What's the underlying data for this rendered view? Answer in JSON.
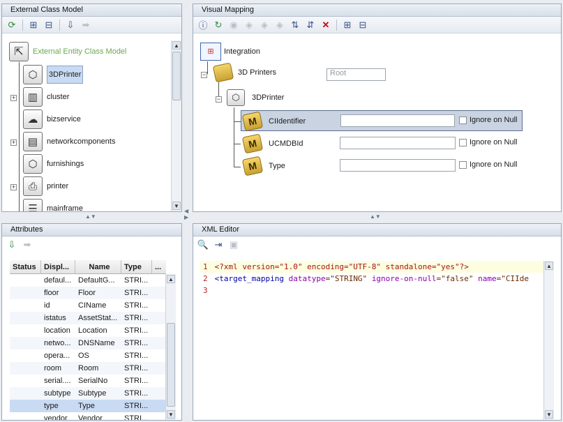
{
  "panels": {
    "external_class_model": {
      "title": "External Class Model",
      "tree": {
        "root_label": "External Entity Class Model",
        "items": [
          {
            "label": "3DPrinter",
            "icon": "cube-icon",
            "selected": true,
            "expandable": false
          },
          {
            "label": "cluster",
            "icon": "cluster-icon",
            "selected": false,
            "expandable": true
          },
          {
            "label": "bizservice",
            "icon": "bizservice-icon",
            "selected": false,
            "expandable": false
          },
          {
            "label": "networkcomponents",
            "icon": "network-icon",
            "selected": false,
            "expandable": true
          },
          {
            "label": "furnishings",
            "icon": "cube-icon",
            "selected": false,
            "expandable": false
          },
          {
            "label": "printer",
            "icon": "printer-icon",
            "selected": false,
            "expandable": true
          },
          {
            "label": "mainframe",
            "icon": "mainframe-icon",
            "selected": false,
            "expandable": false
          }
        ]
      }
    },
    "visual_mapping": {
      "title": "Visual Mapping",
      "root": "Integration",
      "ci_type": "3D Printers",
      "ci_type_placeholder": "Root",
      "entity": "3DPrinter",
      "attributes": [
        {
          "name": "CIIdentifier",
          "value": "",
          "ignore_label": "Ignore on Null",
          "selected": true
        },
        {
          "name": "UCMDBId",
          "value": "",
          "ignore_label": "Ignore on Null",
          "selected": false
        },
        {
          "name": "Type",
          "value": "",
          "ignore_label": "Ignore on Null",
          "selected": false
        }
      ]
    },
    "attributes": {
      "title": "Attributes",
      "columns": [
        "Status",
        "Displ...",
        "Name",
        "Type",
        "..."
      ],
      "rows": [
        {
          "display": "defaul...",
          "name": "DefaultG...",
          "type": "STRI..."
        },
        {
          "display": "floor",
          "name": "Floor",
          "type": "STRI..."
        },
        {
          "display": "id",
          "name": "CIName",
          "type": "STRI..."
        },
        {
          "display": "istatus",
          "name": "AssetStat...",
          "type": "STRI..."
        },
        {
          "display": "location",
          "name": "Location",
          "type": "STRI..."
        },
        {
          "display": "netwo...",
          "name": "DNSName",
          "type": "STRI..."
        },
        {
          "display": "opera...",
          "name": "OS",
          "type": "STRI..."
        },
        {
          "display": "room",
          "name": "Room",
          "type": "STRI..."
        },
        {
          "display": "serial....",
          "name": "SerialNo",
          "type": "STRI..."
        },
        {
          "display": "subtype",
          "name": "Subtype",
          "type": "STRI..."
        },
        {
          "display": "type",
          "name": "Type",
          "type": "STRI...",
          "selected": true
        },
        {
          "display": "vendor",
          "name": "Vendor",
          "type": "STRI..."
        }
      ]
    },
    "xml_editor": {
      "title": "XML Editor",
      "lines": [
        {
          "num": "1",
          "pi": "<?xml version=\"1.0\" encoding=\"UTF-8\" standalone=\"yes\"?>"
        },
        {
          "num": "2",
          "tag_open": "<target_mapping",
          "attr1": "datatype",
          "val1": "=\"STRING\"",
          "attr2": "ignore-on-null",
          "val2": "=\"false\"",
          "attr3": "name",
          "val3": "=\"CIIde"
        },
        {
          "num": "3"
        }
      ]
    }
  },
  "colors": {
    "root_label": "#6aa84f",
    "selection": "#c9dbf3",
    "panel_border": "#9aa7b8",
    "delete_icon": "#d0021b"
  }
}
